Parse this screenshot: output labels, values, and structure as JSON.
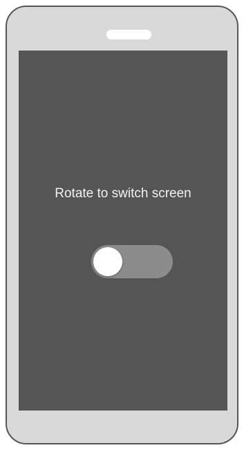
{
  "screen": {
    "message": "Rotate to switch screen"
  },
  "toggle": {
    "state": "off"
  },
  "icons": {
    "speaker": "speaker-slot-icon"
  },
  "colors": {
    "frame": "#d9d9d9",
    "frame_border": "#555555",
    "screen": "#555555",
    "toggle_track": "#8c8c8c",
    "toggle_knob": "#ffffff",
    "text": "#f2f2f2"
  }
}
